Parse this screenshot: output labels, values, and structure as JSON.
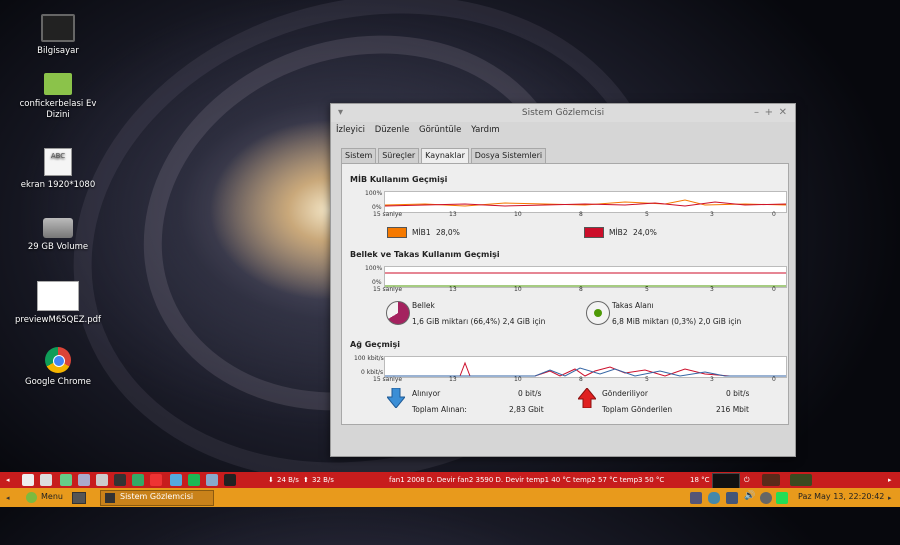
{
  "desktop": {
    "icons": [
      {
        "label": "Bilgisayar"
      },
      {
        "label": "confickerbelasi Ev Dizini"
      },
      {
        "label": "ekran 1920*1080",
        "icon_text": "ABC"
      },
      {
        "label": "29 GB Volume"
      },
      {
        "label": "previewM65QEZ.pdf"
      },
      {
        "label": "Google Chrome"
      }
    ]
  },
  "window": {
    "title": "Sistem Gözlemcisi",
    "menu": [
      "İzleyici",
      "Düzenle",
      "Görüntüle",
      "Yardım"
    ],
    "tabs": [
      "Sistem",
      "Süreçler",
      "Kaynaklar",
      "Dosya Sistemleri"
    ],
    "active_tab": "Kaynaklar",
    "cpu": {
      "title": "MİB Kullanım Geçmişi",
      "y_top": "100%",
      "y_bottom": "0%",
      "x_labels": [
        "15 saniye",
        "13",
        "10",
        "8",
        "5",
        "3",
        "0"
      ],
      "cpu1_label": "MİB1",
      "cpu1_value": "28,0%",
      "cpu1_color": "#f57900",
      "cpu2_label": "MİB2",
      "cpu2_value": "24,0%",
      "cpu2_color": "#cc0e2a"
    },
    "memory": {
      "title": "Bellek ve Takas Kullanım Geçmişi",
      "y_top": "100%",
      "y_bottom": "0%",
      "x_labels": [
        "15 saniye",
        "13",
        "10",
        "8",
        "5",
        "3",
        "0"
      ],
      "mem_label": "Bellek",
      "mem_detail": "1,6 GiB miktarı (66,4%) 2,4 GiB için",
      "mem_color": "#a4225f",
      "mem_fraction": 0.664,
      "swap_label": "Takas Alanı",
      "swap_detail": "6,8 MiB miktarı (0,3%) 2,0 GiB için",
      "swap_color": "#4e9a06",
      "swap_fraction": 0.003
    },
    "network": {
      "title": "Ağ Geçmişi",
      "y_top": "100 kbit/s",
      "y_bottom": "0 kbit/s",
      "x_labels": [
        "15 saniye",
        "13",
        "10",
        "8",
        "5",
        "3",
        "0"
      ],
      "recv_label": "Alınıyor",
      "recv_value": "0 bit/s",
      "recv_total_label": "Toplam Alınan:",
      "recv_total": "2,83 Gbit",
      "send_label": "Gönderiliyor",
      "send_value": "0 bit/s",
      "send_total_label": "Toplam Gönderilen",
      "send_total": "216 Mbit"
    }
  },
  "panel_top": {
    "net_down": "24 B/s",
    "net_up": "32 B/s",
    "sensors": "fan1 2008 D. Devir fan2 3590 D. Devir temp1 40 °C temp2 57 °C temp3 50 °C",
    "temperature": "18 °C"
  },
  "panel_bottom": {
    "menu_label": "Menu",
    "task_label": "Sistem Gözlemcisi",
    "clock": "Paz May 13, 22:20:42"
  }
}
